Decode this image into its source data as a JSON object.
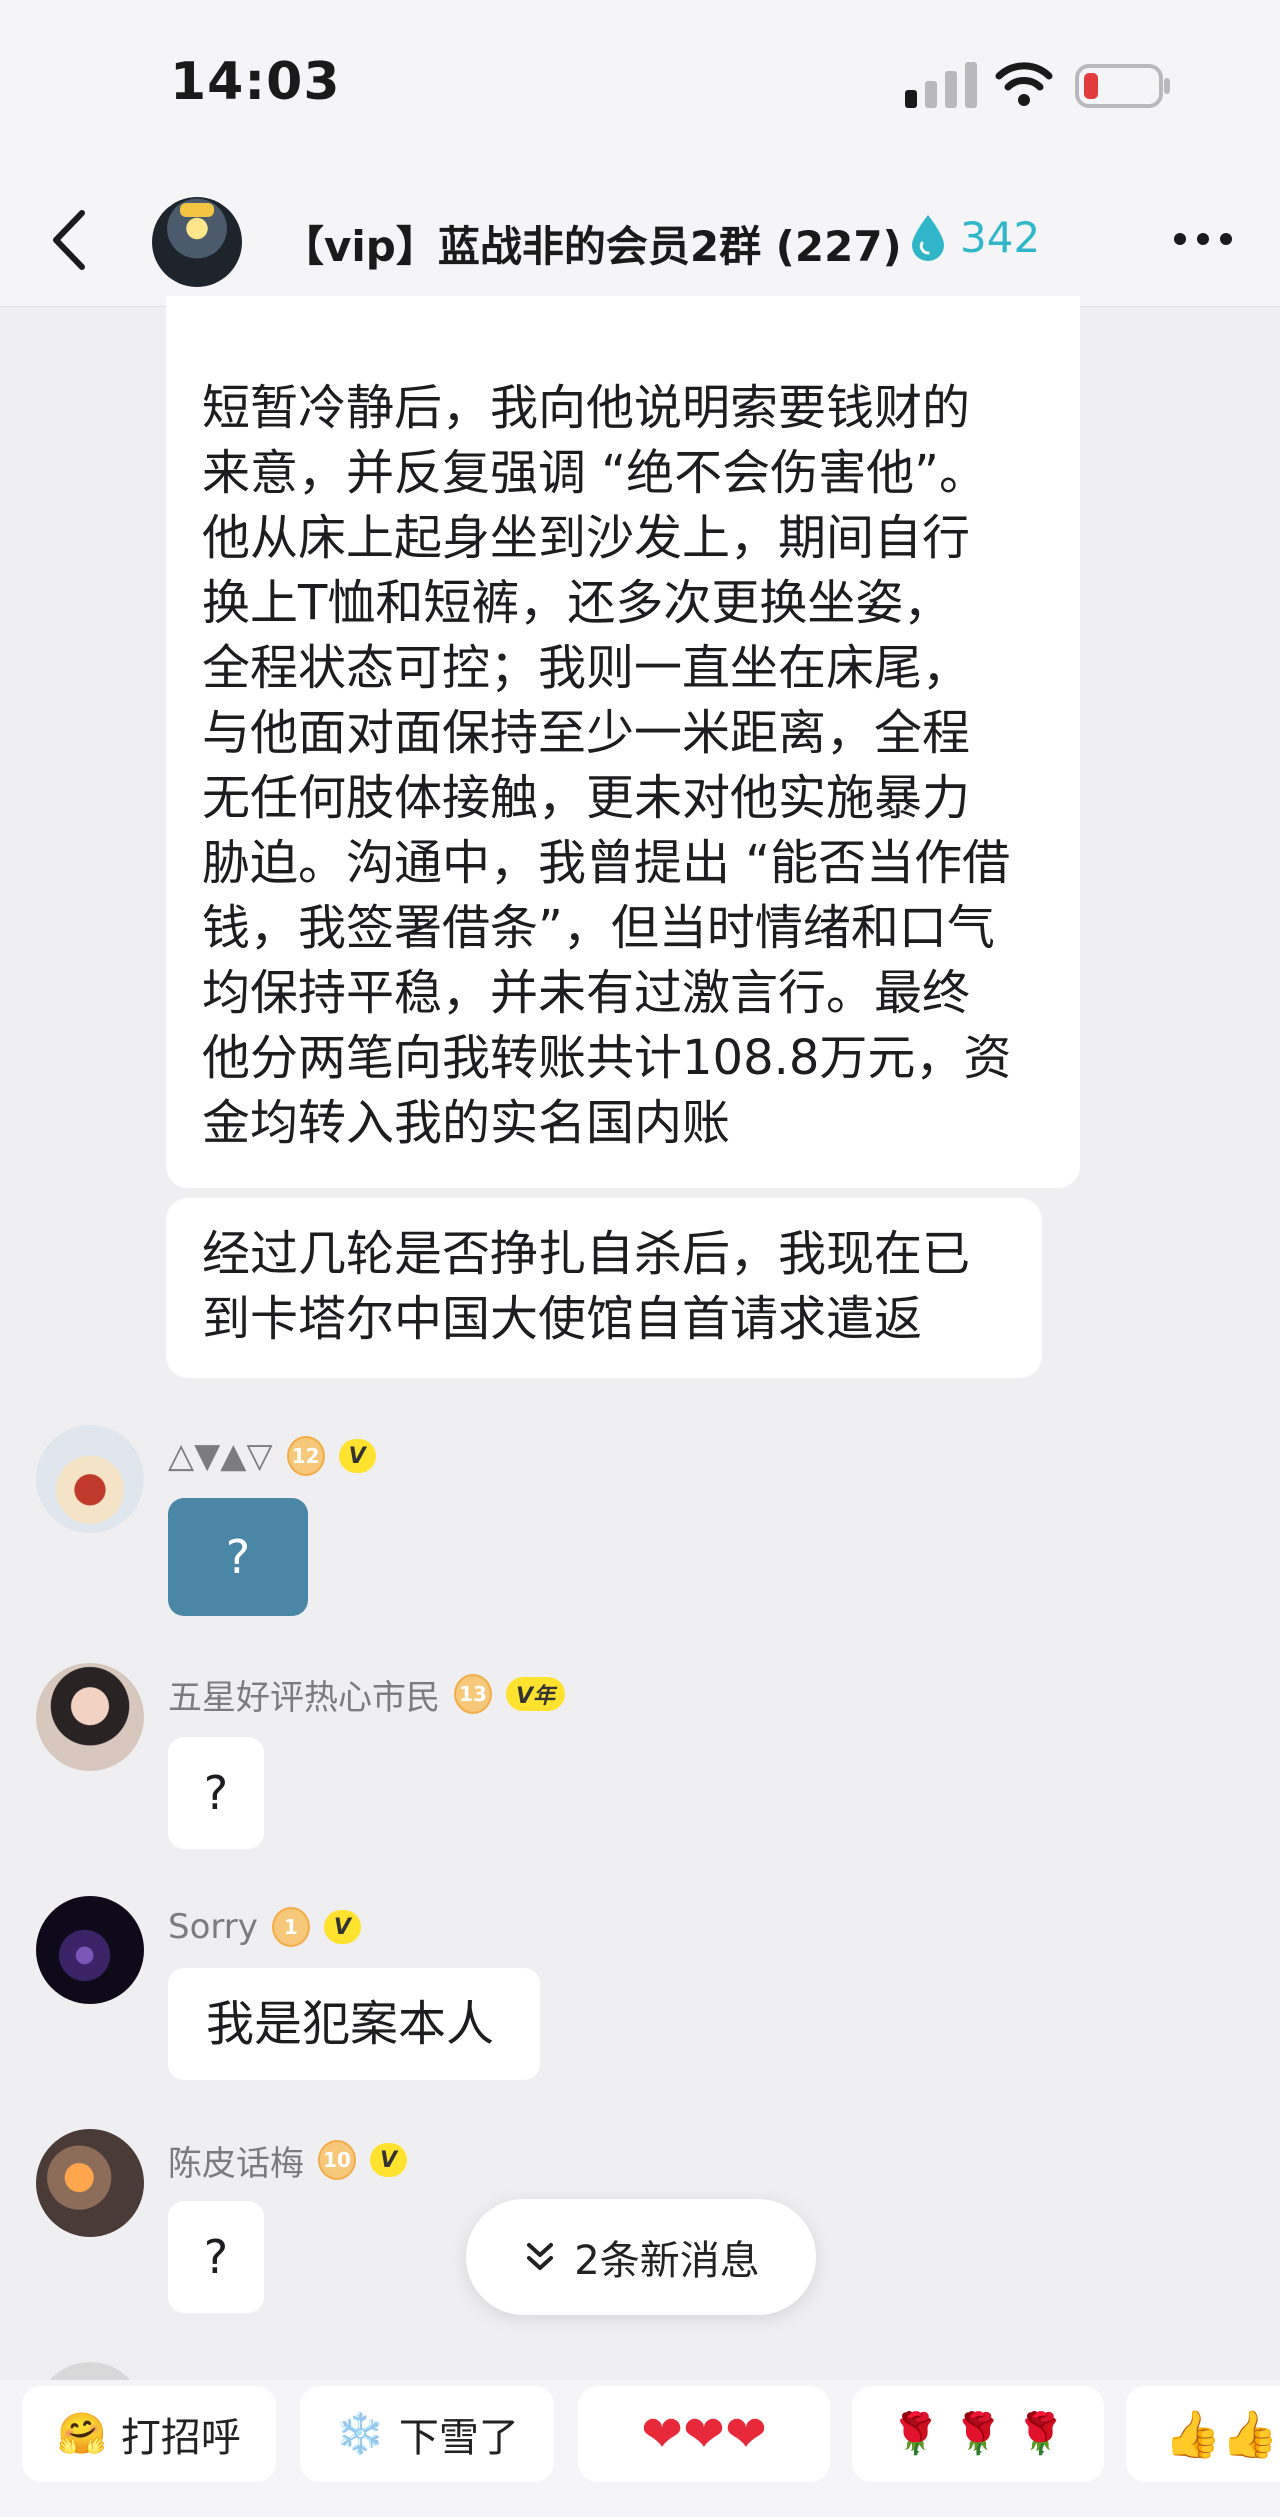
{
  "status_bar": {
    "time": "14:03"
  },
  "header": {
    "title": "【vip】蓝战非的会员2群 (227)",
    "heat_count": "342"
  },
  "messages": {
    "main_lines": [
      "短暂冷静后，我向他说明索要钱财的",
      "来意，并反复强调 “绝不会伤害他”。",
      "他从床上起身坐到沙发上，期间自行",
      "换上T恤和短裤，还多次更换坐姿，",
      "全程状态可控；我则一直坐在床尾，",
      "与他面对面保持至少一米距离，全程",
      "无任何肢体接触，更未对他实施暴力",
      "胁迫。沟通中，我曾提出 “能否当作借",
      "钱，我签署借条”，但当时情绪和口气",
      "均保持平稳，并未有过激言行。最终",
      "他分两笔向我转账共计108.8万元，资",
      "金均转入我的实名国内账"
    ],
    "second_lines": [
      "经过几轮是否挣扎自杀后，我现在已",
      "到卡塔尔中国大使馆自首请求遣返"
    ],
    "replies": [
      {
        "name": "△▼▲▽",
        "level": "12",
        "badge": "V",
        "text": "?"
      },
      {
        "name": "五星好评热心市民",
        "level": "13",
        "badge": "V年",
        "text": "?"
      },
      {
        "name": "Sorry",
        "level": "1",
        "badge": "V",
        "text": "我是犯案本人"
      },
      {
        "name": "陈皮话梅",
        "level": "10",
        "badge": "V",
        "text": "?"
      }
    ]
  },
  "new_messages": {
    "label": "2条新消息"
  },
  "quick_replies": [
    {
      "emoji": "🤗",
      "label": "打招呼"
    },
    {
      "emoji": "❄️",
      "label": "下雪了"
    },
    {
      "emoji": "❤❤❤",
      "label": ""
    },
    {
      "emoji": "🌹 🌹 🌹",
      "label": ""
    },
    {
      "emoji": "👍👍",
      "label": ""
    }
  ],
  "colors": {
    "accent": "#2fb6c8",
    "reply_bubble_blue": "#4a86a6",
    "vip_badge": "#ffe22e",
    "background": "#efeff1"
  }
}
